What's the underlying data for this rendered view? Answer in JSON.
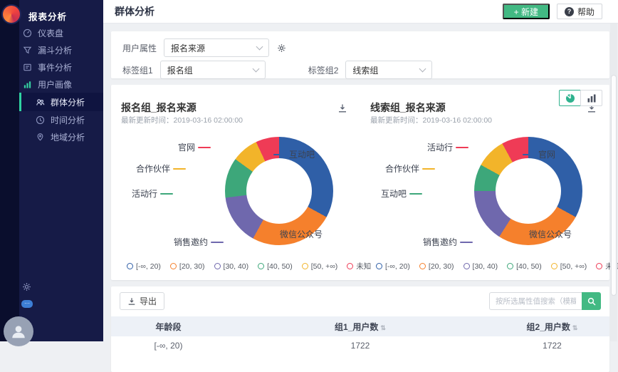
{
  "sidebar": {
    "title": "报表分析",
    "items": [
      {
        "label": "仪表盘",
        "icon": "gauge-icon"
      },
      {
        "label": "漏斗分析",
        "icon": "funnel-icon"
      },
      {
        "label": "事件分析",
        "icon": "event-icon"
      },
      {
        "label": "用户画像",
        "icon": "bar-chart-icon"
      },
      {
        "label": "群体分析",
        "icon": "group-icon",
        "active": true
      },
      {
        "label": "时间分析",
        "icon": "clock-icon"
      },
      {
        "label": "地域分析",
        "icon": "map-pin-icon"
      }
    ]
  },
  "header": {
    "title": "群体分析",
    "new_button": "+ 新建",
    "help_button": "帮助",
    "help_icon": "?"
  },
  "filters": {
    "attr_label": "用户属性",
    "attr_value": "报名来源",
    "group1_label": "标签组1",
    "group1_value": "报名组",
    "group2_label": "标签组2",
    "group2_value": "线索组"
  },
  "chart_toolbar": {
    "modes": [
      "pie",
      "bar"
    ],
    "active": "pie"
  },
  "legend": [
    {
      "label": "[-∞, 20)",
      "color": "#2f5fa7"
    },
    {
      "label": "[20, 30)",
      "color": "#f5802c"
    },
    {
      "label": "[30, 40)",
      "color": "#6f68ad"
    },
    {
      "label": "[40, 50)",
      "color": "#3da77a"
    },
    {
      "label": "[50, +∞)",
      "color": "#f2b42a"
    },
    {
      "label": "未知",
      "color": "#ef3b56"
    }
  ],
  "chart_data": [
    {
      "type": "pie",
      "donut": true,
      "title": "报名组_报名来源",
      "updated_label": "最新更新时间：",
      "updated": "2019-03-16 02:00:00",
      "slices": [
        {
          "label": "互动吧",
          "value": 33,
          "color": "#2f5fa7"
        },
        {
          "label": "微信公众号",
          "value": 25,
          "color": "#f5802c"
        },
        {
          "label": "销售邀约",
          "value": 15,
          "color": "#6f68ad"
        },
        {
          "label": "活动行",
          "value": 12,
          "color": "#3da77a"
        },
        {
          "label": "合作伙伴",
          "value": 8,
          "color": "#f2b42a"
        },
        {
          "label": "官网",
          "value": 7,
          "color": "#ef3b56"
        }
      ]
    },
    {
      "type": "pie",
      "donut": true,
      "title": "线索组_报名来源",
      "updated_label": "最新更新时间：",
      "updated": "2019-03-16 02:00:00",
      "slices": [
        {
          "label": "官网",
          "value": 33,
          "color": "#2f5fa7"
        },
        {
          "label": "微信公众号",
          "value": 26,
          "color": "#f5802c"
        },
        {
          "label": "销售邀约",
          "value": 16,
          "color": "#6f68ad"
        },
        {
          "label": "互动吧",
          "value": 8,
          "color": "#3da77a"
        },
        {
          "label": "合作伙伴",
          "value": 9,
          "color": "#f2b42a"
        },
        {
          "label": "活动行",
          "value": 8,
          "color": "#ef3b56"
        }
      ]
    }
  ],
  "table": {
    "export_label": "导出",
    "search_placeholder": "按所选属性值搜索（模糊或精确）",
    "columns": [
      {
        "label": "年龄段",
        "sortable": false
      },
      {
        "label": "组1_用户数",
        "sortable": true
      },
      {
        "label": "组2_用户数",
        "sortable": true
      }
    ],
    "rows": [
      [
        "[-∞, 20)",
        "1722",
        "1722"
      ]
    ]
  },
  "icons": {
    "sort": "⇅",
    "chat_dots": "···"
  },
  "colors": {
    "accent_green": "#42b983",
    "sidebar_active": "#2fd3a2"
  }
}
